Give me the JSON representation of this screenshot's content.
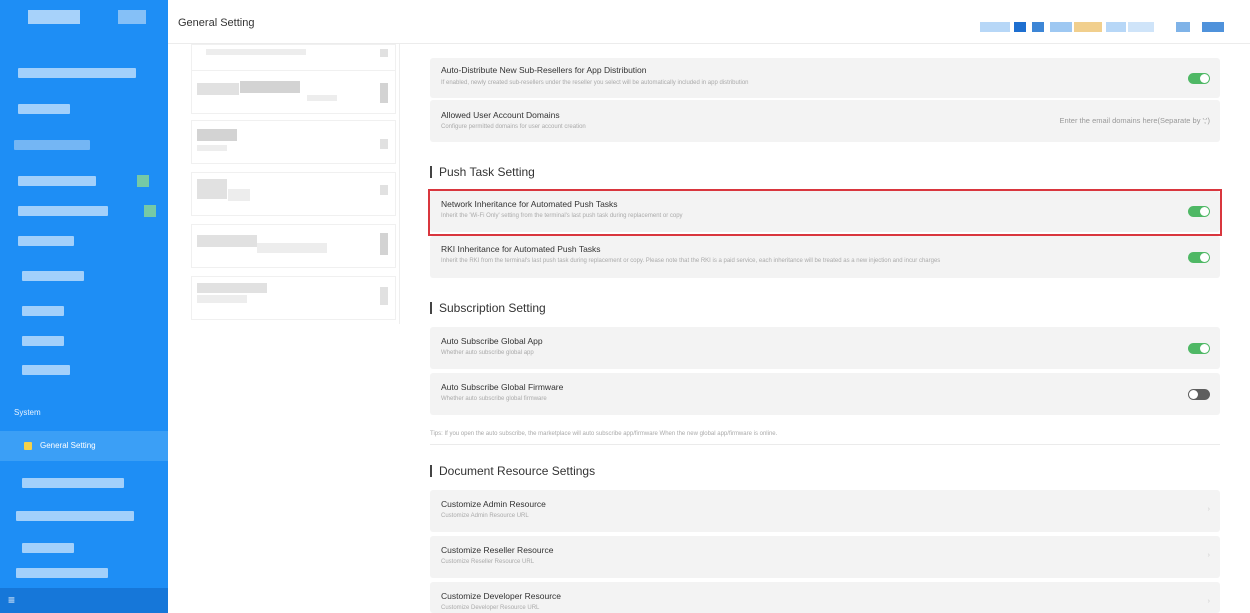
{
  "sidebar": {
    "section_label": "System",
    "active_item": "General Setting",
    "menu_icon": "hamburger-icon"
  },
  "header": {
    "title": "General Setting"
  },
  "settings": {
    "auto_distribute": {
      "title": "Auto-Distribute New Sub-Resellers for App Distribution",
      "desc": "If enabled, newly created sub-resellers under the reseller you select will be automatically included in app distribution",
      "enabled": true
    },
    "allowed_domains": {
      "title": "Allowed User Account Domains",
      "desc": "Configure permitted domains for user account creation",
      "placeholder": "Enter the email domains here(Separate by ';')"
    },
    "push_task_heading": "Push Task Setting",
    "network_inheritance": {
      "title": "Network Inheritance for Automated Push Tasks",
      "desc": "Inherit the 'Wi-Fi Only' setting from the terminal's last push task during replacement or copy",
      "enabled": true
    },
    "rki_inheritance": {
      "title": "RKI Inheritance for Automated Push Tasks",
      "desc": "Inherit the RKI from the terminal's last push task during replacement or copy. Please note that the RKI is a paid service, each inheritance will be treated as a new injection and incur charges",
      "enabled": true
    },
    "subscription_heading": "Subscription Setting",
    "auto_subscribe_app": {
      "title": "Auto Subscribe Global App",
      "desc": "Whether auto subscribe global app",
      "enabled": true
    },
    "auto_subscribe_firmware": {
      "title": "Auto Subscribe Global Firmware",
      "desc": "Whether auto subscribe global firmware",
      "enabled": false
    },
    "subscription_tip": "Tips: If you open the auto subscribe,  the marketplace will auto subscribe app/firmware When the new global app/firmware is online.",
    "document_heading": "Document Resource Settings",
    "admin_resource": {
      "title": "Customize Admin Resource",
      "desc": "Customize Admin Resource URL"
    },
    "reseller_resource": {
      "title": "Customize Reseller Resource",
      "desc": "Customize Reseller Resource URL"
    },
    "developer_resource": {
      "title": "Customize Developer Resource",
      "desc": "Customize Developer Resource URL"
    },
    "chevron": "›"
  },
  "colors": {
    "sidebar": "#1e8ef5",
    "toggle_on": "#4fb865",
    "toggle_off": "#5e5e5e",
    "highlight": "#d9363e"
  }
}
